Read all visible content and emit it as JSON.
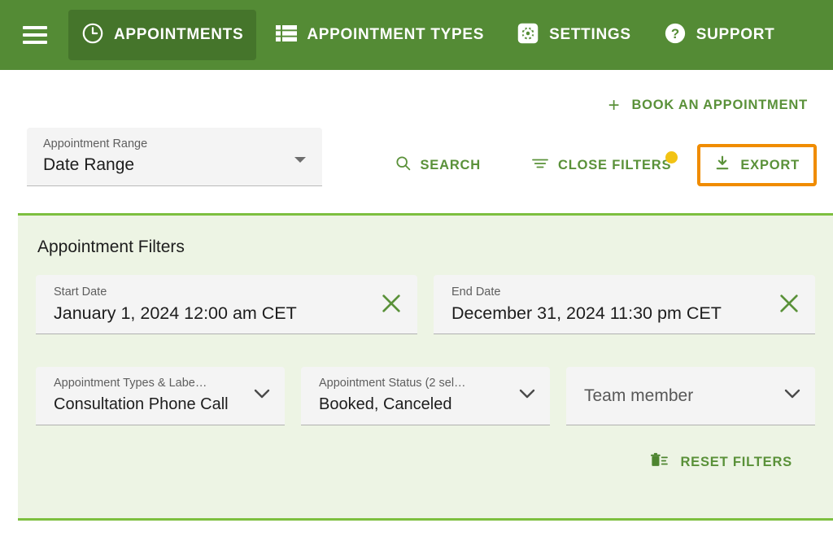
{
  "colors": {
    "header_green": "#548B35",
    "active_tab_green": "#45752B",
    "link_green": "#5A9139",
    "panel_bg": "#EDF4E4",
    "panel_border": "#7DBF3F",
    "export_highlight_orange": "#F08C00",
    "badge_yellow": "#F2C314",
    "field_bg": "#F4F4F4"
  },
  "topnav": {
    "menu_icon": "hamburger-menu-icon",
    "items": [
      {
        "label": "APPOINTMENTS",
        "icon": "clock-icon",
        "active": true
      },
      {
        "label": "APPOINTMENT TYPES",
        "icon": "list-table-icon",
        "active": false
      },
      {
        "label": "SETTINGS",
        "icon": "gear-icon",
        "active": false
      },
      {
        "label": "SUPPORT",
        "icon": "question-circle-icon",
        "active": false
      }
    ]
  },
  "book": {
    "label": "BOOK AN APPOINTMENT",
    "icon": "plus-icon"
  },
  "range_select": {
    "label": "Appointment Range",
    "value": "Date Range",
    "caret_icon": "caret-down-icon"
  },
  "actions": {
    "search": {
      "label": "SEARCH",
      "icon": "search-icon"
    },
    "close_filters": {
      "label": "CLOSE FILTERS",
      "icon": "filter-icon",
      "badge": true
    },
    "export": {
      "label": "EXPORT",
      "icon": "download-icon"
    }
  },
  "filters": {
    "title": "Appointment Filters",
    "start_date": {
      "label": "Start Date",
      "value": "January 1, 2024 12:00 am CET",
      "clear_icon": "close-x-icon"
    },
    "end_date": {
      "label": "End Date",
      "value": "December 31, 2024 11:30 pm CET",
      "clear_icon": "close-x-icon"
    },
    "types_labels": {
      "label": "Appointment Types & Labe…",
      "value": "Consultation Phone Call",
      "chevron_icon": "chevron-down-icon"
    },
    "status": {
      "label": "Appointment Status (2 sel…",
      "value": "Booked, Canceled",
      "chevron_icon": "chevron-down-icon"
    },
    "team_member": {
      "placeholder": "Team member",
      "value": "",
      "chevron_icon": "chevron-down-icon"
    },
    "reset": {
      "label": "RESET FILTERS",
      "icon": "trash-icon"
    }
  }
}
